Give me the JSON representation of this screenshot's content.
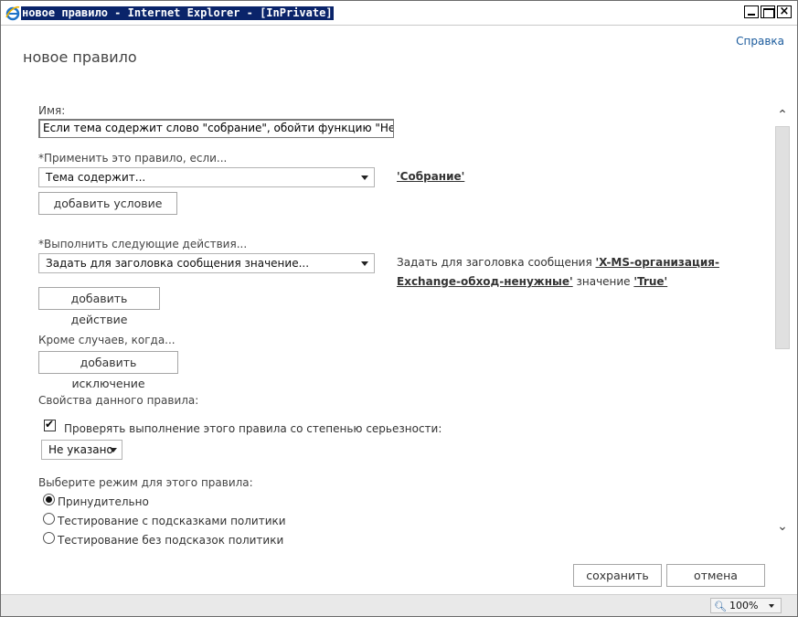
{
  "window": {
    "title": "новое правило - Internet Explorer - [InPrivate]",
    "icon": "ie-icon"
  },
  "header": {
    "help_link": "Справка",
    "page_title": "новое правило"
  },
  "form": {
    "name_label": "Имя:",
    "name_value": "Если тема содержит слово \"собрание\", обойти функцию \"Ненужные\"",
    "condition_label": "*Применить это правило, если...",
    "condition_select": "Тема содержит...",
    "condition_value": "'Собрание'",
    "add_condition": "добавить условие",
    "actions_label": "*Выполнить следующие действия...",
    "action_select": "Задать для заголовка сообщения значение...",
    "action_desc_prefix": "Задать для заголовка сообщения ",
    "action_header_link": "'X-MS-организация-Exchange-обход-ненужные'",
    "action_desc_middle": " значение ",
    "action_value_link": "'True'",
    "add_action": "добавить действие",
    "exceptions_label": "Кроме случаев, когда...",
    "add_exception": "добавить исключение",
    "properties_label": "Свойства данного правила:",
    "severity_checkbox_label": "Проверять выполнение этого правила со степенью серьезности:",
    "severity_checked": true,
    "severity_select": "Не указано",
    "mode_label": "Выберите режим для этого правила:",
    "modes": [
      {
        "label": "Принудительно",
        "selected": true
      },
      {
        "label": "Тестирование с подсказками политики",
        "selected": false
      },
      {
        "label": "Тестирование без подсказок политики",
        "selected": false
      }
    ]
  },
  "footer": {
    "save": "сохранить",
    "cancel": "отмена"
  },
  "statusbar": {
    "zoom": "100%"
  },
  "colors": {
    "link": "#1a5a9c",
    "title_highlight": "#0a246a"
  }
}
